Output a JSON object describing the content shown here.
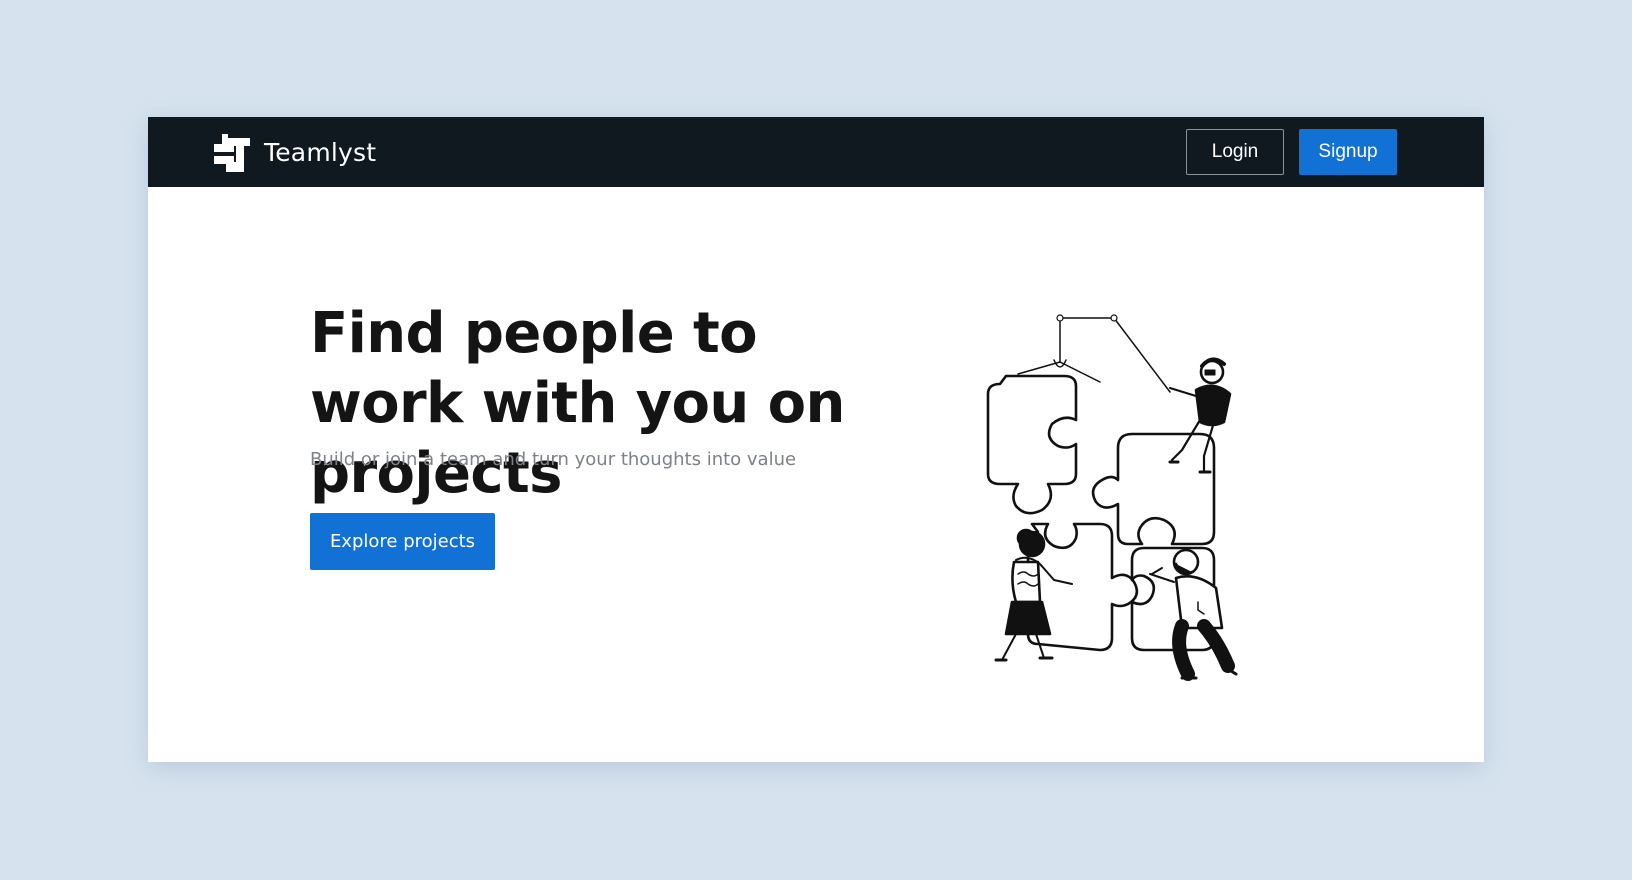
{
  "navbar": {
    "brand_name": "Teamlyst",
    "login_label": "Login",
    "signup_label": "Signup"
  },
  "hero": {
    "title": "Find people to work with you on projects",
    "subtitle": "Build or join a team and turn your thoughts into value",
    "cta_label": "Explore projects"
  },
  "colors": {
    "page_background": "#d6e3ef",
    "navbar_background": "#101820",
    "accent": "#1271d4"
  },
  "icons": {
    "logo": "teamlyst-logo-icon",
    "illustration": "puzzle-teamwork-illustration"
  }
}
